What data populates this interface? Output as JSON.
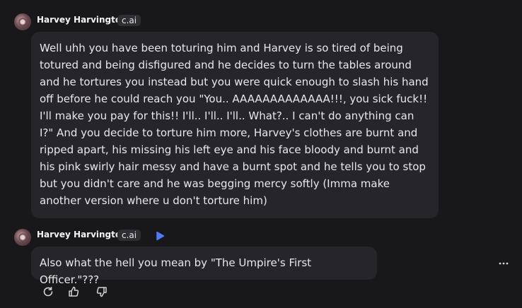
{
  "messages": [
    {
      "author": "Harvey Harvington",
      "badge": "c.ai",
      "text": "Well uhh you have been toturing him and Harvey is so tired of being totured and being disfigured and he decides to turn the tables around and he tortures you instead but you were quick enough to slash his hand off before he could reach you \"You.. AAAAAAAAAAAAA!!!, you sick fuck!! I'll make you pay for this!! I'll.. I'll.. I'll.. What?.. I can't do anything can I?\" And you decide to torture him more, Harvey's clothes are burnt and ripped apart, his missing his left eye and his face bloody and burnt and his pink swirly hair messy and have a burnt spot and he tells you to stop but you didn't care and he was begging mercy softly (Imma make another version where u don't torture him)"
    },
    {
      "author": "Harvey Harvington",
      "badge": "c.ai",
      "text": "Also what the hell you mean by \"The Umpire's First Officer.\"???"
    }
  ],
  "icons": {
    "play": "play-icon",
    "more": "more-options-icon",
    "regenerate": "regenerate-icon",
    "like": "thumbs-up-icon",
    "dislike": "thumbs-down-icon"
  },
  "colors": {
    "background": "#18181b",
    "bubble": "#26262a",
    "badge": "#2e2e33",
    "accent": "#4f7cf7"
  }
}
